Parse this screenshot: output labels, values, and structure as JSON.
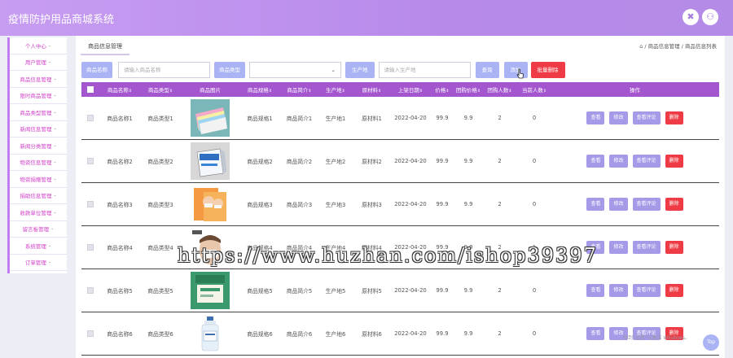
{
  "header": {
    "title": "疫情防护用品商城系统",
    "fullscreen_icon": "✖",
    "user_icon": "⚇"
  },
  "sidebar": {
    "items": [
      {
        "label": "个人中心"
      },
      {
        "label": "用户管理"
      },
      {
        "label": "商品信息管理"
      },
      {
        "label": "限时商品管理"
      },
      {
        "label": "商品类型管理"
      },
      {
        "label": "新闻信息管理"
      },
      {
        "label": "新闻分类管理"
      },
      {
        "label": "物资信息管理"
      },
      {
        "label": "物资捐赠管理"
      },
      {
        "label": "捐助信息管理"
      },
      {
        "label": "收款单位管理"
      },
      {
        "label": "留言板管理"
      },
      {
        "label": "系统管理"
      },
      {
        "label": "订单管理"
      }
    ]
  },
  "main": {
    "tab": "商品信息管理",
    "breadcrumb": "⌂ / 商品信息管理 / 商品信息列表",
    "search": {
      "name_label": "商品名称",
      "name_placeholder": "请输入商品名称",
      "type_label": "商品类型",
      "type_value": "",
      "producer_label": "生产地",
      "producer_placeholder": "请输入生产地",
      "query_button": "查询",
      "add_button": "添加",
      "batch_delete_button": "批量删除"
    },
    "columns": [
      "商品名称",
      "商品类型",
      "商品图片",
      "商品规格",
      "商品简介",
      "生产地",
      "原材料",
      "上架日期",
      "价格",
      "团购价格",
      "团购人数",
      "当前人数",
      "操作"
    ],
    "actions": {
      "view": "查看",
      "edit": "修改",
      "review": "查看评论",
      "delete": "删除"
    },
    "rows": [
      {
        "name": "商品名称1",
        "type": "商品类型1",
        "spec": "商品规格1",
        "intro": "商品简介1",
        "producer": "生产地1",
        "material": "原材料1",
        "date": "2022-04-20",
        "price": "99.9",
        "group_price": "9.9",
        "group_size": "2",
        "current": "0",
        "thumb": "masks"
      },
      {
        "name": "商品名称2",
        "type": "商品类型2",
        "spec": "商品规格2",
        "intro": "商品简介2",
        "producer": "生产地2",
        "material": "原材料2",
        "date": "2022-04-20",
        "price": "99.9",
        "group_price": "9.9",
        "group_size": "2",
        "current": "0",
        "thumb": "box"
      },
      {
        "name": "商品名称3",
        "type": "商品类型3",
        "spec": "商品规格3",
        "intro": "商品简介3",
        "producer": "生产地3",
        "material": "原材料3",
        "date": "2022-04-20",
        "price": "99.9",
        "group_price": "9.9",
        "group_size": "2",
        "current": "0",
        "thumb": "kids"
      },
      {
        "name": "商品名称4",
        "type": "商品类型4",
        "spec": "商品规格4",
        "intro": "商品简介4",
        "producer": "生产地4",
        "material": "原材料4",
        "date": "2022-04-20",
        "price": "99.9",
        "group_price": "9.9",
        "group_size": "2",
        "current": "1",
        "thumb": "face"
      },
      {
        "name": "商品名称5",
        "type": "商品类型5",
        "spec": "商品规格5",
        "intro": "商品简介5",
        "producer": "生产地5",
        "material": "原材料5",
        "date": "2022-04-20",
        "price": "99.9",
        "group_price": "9.9",
        "group_size": "2",
        "current": "0",
        "thumb": "green"
      },
      {
        "name": "商品名称6",
        "type": "商品类型6",
        "spec": "商品规格6",
        "intro": "商品简介6",
        "producer": "生产地6",
        "material": "原材料6",
        "date": "2022-04-20",
        "price": "99.9",
        "group_price": "9.9",
        "group_size": "2",
        "current": "0",
        "thumb": "bottle"
      }
    ]
  },
  "watermark": "https://www.huzhan.com/ishop39397",
  "activate_windows": "转到\"设置\"以激活 Windows。",
  "top_button": "Top",
  "colors": {
    "header": "#b78aea",
    "table_head": "#a456cf",
    "button": "#aab4f4",
    "delete": "#ee3b45"
  }
}
